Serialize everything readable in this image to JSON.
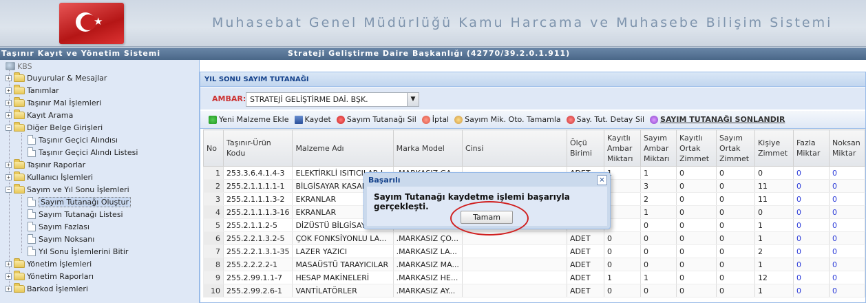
{
  "banner": {
    "title": "Muhasebat Genel Müdürlüğü Kamu Harcama ve Muhasebe Bilişim Sistemi"
  },
  "topbar": {
    "left": "Taşınır Kayıt ve Yönetim Sistemi",
    "center": "Strateji Geliştirme Daire Başkanlığı (42770/39.2.0.1.911)"
  },
  "sidebar": {
    "root": "KBS",
    "items": [
      {
        "label": "Duyurular & Mesajlar"
      },
      {
        "label": "Tanımlar"
      },
      {
        "label": "Taşınır Mal İşlemleri"
      },
      {
        "label": "Kayıt Arama"
      },
      {
        "label": "Diğer Belge Girişleri"
      },
      {
        "label": "Taşınır Geçici Alındısı"
      },
      {
        "label": "Taşınır Geçici Alındı Listesi"
      },
      {
        "label": "Taşınır Raporlar"
      },
      {
        "label": "Kullanıcı İşlemleri"
      },
      {
        "label": "Sayım ve Yıl Sonu İşlemleri"
      },
      {
        "label": "Sayım Tutanağı Oluştur"
      },
      {
        "label": "Sayım Tutanağı Listesi"
      },
      {
        "label": "Sayım Fazlası"
      },
      {
        "label": "Sayım Noksanı"
      },
      {
        "label": "Yıl Sonu İşlemlerini Bitir"
      },
      {
        "label": "Yönetim İşlemleri"
      },
      {
        "label": "Yönetim Raporları"
      },
      {
        "label": "Barkod İşlemleri"
      }
    ]
  },
  "panel": {
    "title": "YIL SONU SAYIM TUTANAĞI",
    "ambar_label": "AMBAR:",
    "ambar_value": "STRATEJİ GELİŞTİRME DAİ. BŞK.",
    "toolbar": {
      "add": "Yeni Malzeme Ekle",
      "save": "Kaydet",
      "delete": "Sayım Tutanağı Sil",
      "cancel": "İptal",
      "auto": "Sayım Mik. Oto. Tamamla",
      "detail_delete": "Say. Tut. Detay Sil",
      "finish": "SAYIM TUTANAĞI SONLANDIR"
    }
  },
  "table": {
    "headers": [
      "No",
      "Taşınır-Ürün Kodu",
      "Malzeme Adı",
      "Marka Model",
      "Cinsi",
      "Ölçü Birimi",
      "Kayıtlı Ambar Miktarı",
      "Sayım Ambar Miktarı",
      "Kayıtlı Ortak Zimmet",
      "Sayım Ortak Zimmet",
      "Kişiye Zimmet",
      "Fazla Miktar",
      "Noksan Miktar"
    ],
    "rows": [
      [
        "1",
        "253.3.6.4.1.4-3",
        "ELEKTİRKLİ ISITICILAR I...",
        ".MARKASIZ GA...",
        "",
        "ADET",
        "1",
        "1",
        "0",
        "0",
        "0",
        "0",
        "0"
      ],
      [
        "2",
        "255.2.1.1.1.1-1",
        "BİLGİSAYAR KASALA...",
        "",
        "",
        "",
        "",
        "3",
        "0",
        "0",
        "11",
        "0",
        "0"
      ],
      [
        "3",
        "255.2.1.1.1.3-2",
        "EKRANLAR",
        "",
        "",
        "",
        "",
        "2",
        "0",
        "0",
        "11",
        "0",
        "0"
      ],
      [
        "4",
        "255.2.1.1.1.3-16",
        "EKRANLAR",
        "",
        "",
        "",
        "",
        "1",
        "0",
        "0",
        "0",
        "0",
        "0"
      ],
      [
        "5",
        "255.2.1.1.2-5",
        "DİZÜSTÜ BİLGİSAYAR",
        "",
        "",
        "",
        "",
        "0",
        "0",
        "0",
        "1",
        "0",
        "0"
      ],
      [
        "6",
        "255.2.2.1.3.2-5",
        "ÇOK FONKSİYONLU LA...",
        ".MARKASIZ ÇO...",
        "",
        "ADET",
        "0",
        "0",
        "0",
        "0",
        "1",
        "0",
        "0"
      ],
      [
        "7",
        "255.2.2.1.3.1-35",
        "LAZER YAZICI",
        ".MARKASIZ LA...",
        "",
        "ADET",
        "0",
        "0",
        "0",
        "0",
        "2",
        "0",
        "0"
      ],
      [
        "8",
        "255.2.2.2.2-1",
        "MASAÜSTÜ TARAYICILAR",
        ".MARKASIZ MA...",
        "",
        "ADET",
        "0",
        "0",
        "0",
        "0",
        "1",
        "0",
        "0"
      ],
      [
        "9",
        "255.2.99.1.1-7",
        "HESAP MAKİNELERİ",
        ".MARKASIZ HE...",
        "",
        "ADET",
        "1",
        "1",
        "0",
        "0",
        "12",
        "0",
        "0"
      ],
      [
        "10",
        "255.2.99.2.6-1",
        "VANTİLATÖRLER",
        ".MARKASIZ AY...",
        "",
        "ADET",
        "0",
        "0",
        "0",
        "0",
        "1",
        "0",
        "0"
      ]
    ]
  },
  "dialog": {
    "title": "Başarılı",
    "message": "Sayım Tutanağı kaydetme işlemi başarıyla gerçekleşti.",
    "ok_button": "Tamam",
    "close": "×"
  }
}
